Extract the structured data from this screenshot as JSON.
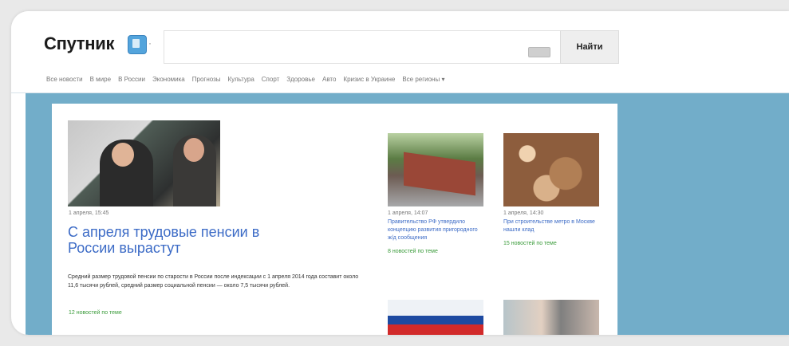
{
  "header": {
    "logo_text": "Спутник",
    "search_placeholder": "",
    "search_button": "Найти"
  },
  "nav": [
    "Все новости",
    "В мире",
    "В России",
    "Экономика",
    "Прогнозы",
    "Культура",
    "Спорт",
    "Здоровье",
    "Авто",
    "Кризис в Украине",
    "Все регионы ▾"
  ],
  "main_story": {
    "date": "1 апреля, 15:45",
    "title": "С апреля трудовые пенсии в России вырастут",
    "lead": "Средний размер трудовой пенсии по старости в России после индексации с 1 апреля 2014 года составит около 11,6 тысячи рублей, средний размер социальной пенсии — около 7,5 тысячи рублей.",
    "more": "12 новостей по теме"
  },
  "cards": [
    {
      "date": "1 апреля, 14:07",
      "title": "Правительство РФ утвердило концепцию развития пригородного ж/д сообщения",
      "more": "8 новостей по теме"
    },
    {
      "date": "1 апреля, 14:30",
      "title": "При строительстве метро в Москве нашли клад",
      "more": "15 новостей по теме"
    }
  ],
  "colors": {
    "accent": "#3c6bc6",
    "background": "#72adc9",
    "green": "#3a9b3a"
  }
}
